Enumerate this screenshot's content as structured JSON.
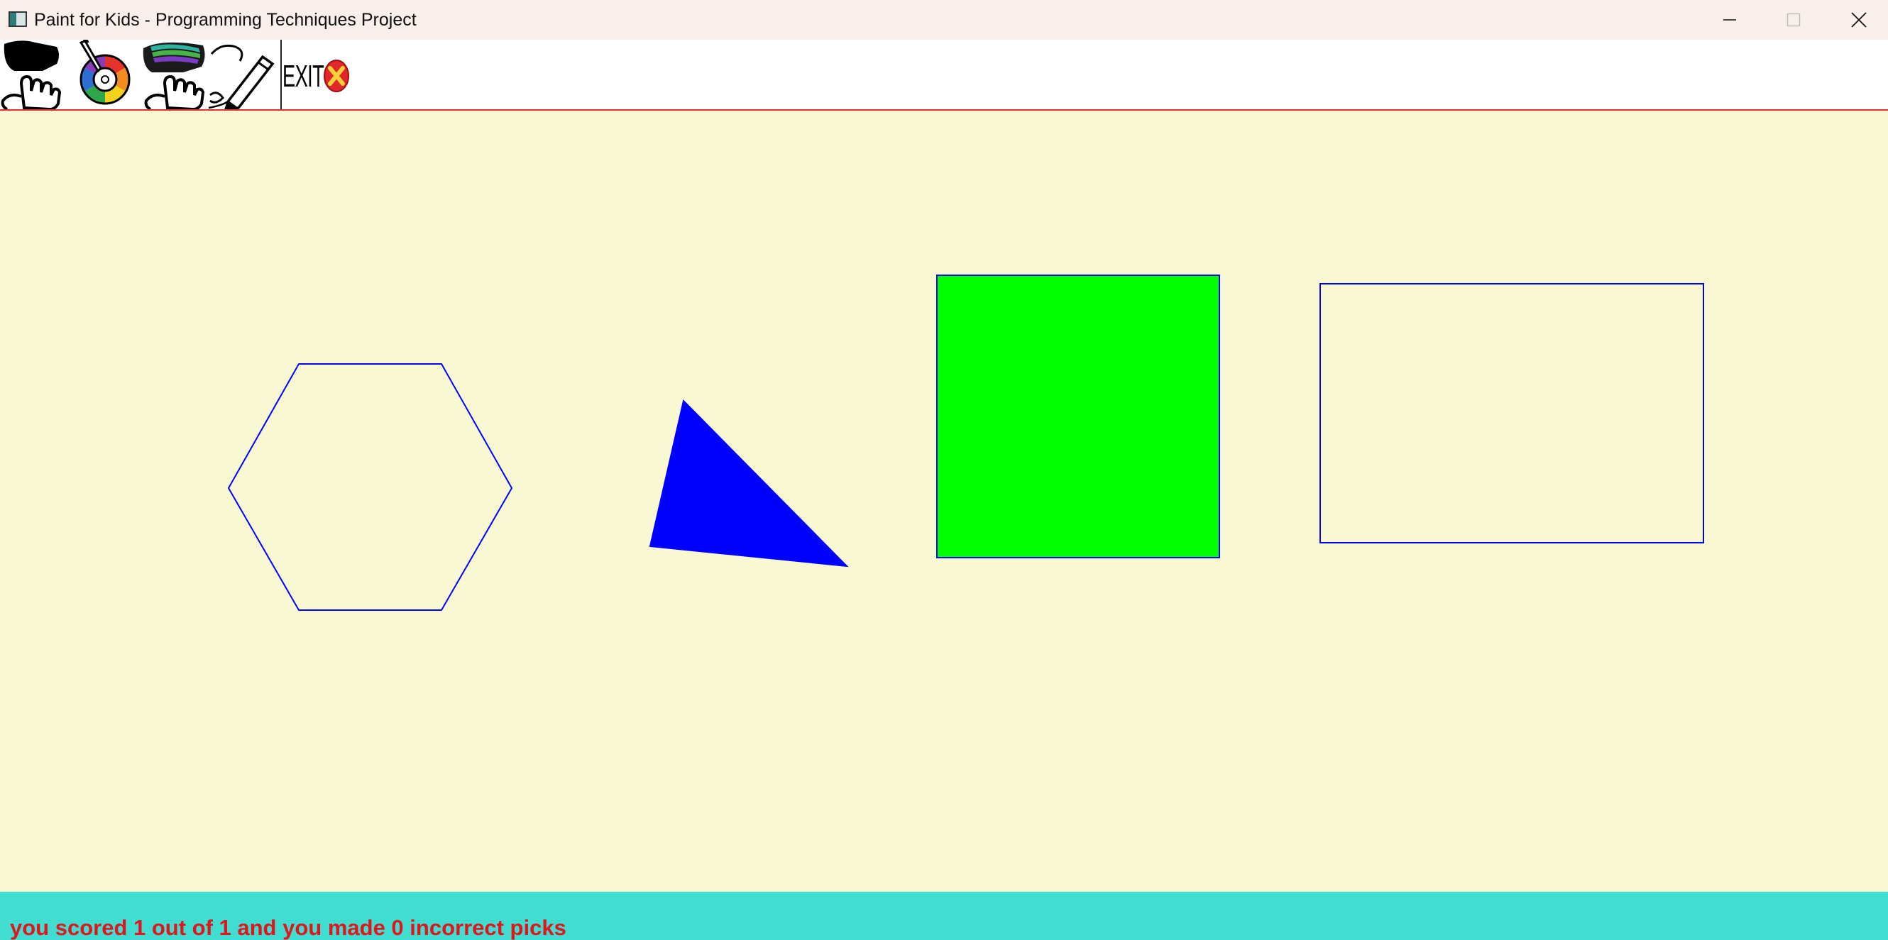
{
  "window": {
    "title": "Paint for Kids - Programming Techniques Project",
    "controls": {
      "minimize": "minimize-icon",
      "maximize": "maximize-icon",
      "close": "close-icon"
    }
  },
  "toolbar": {
    "items": [
      {
        "name": "pick-by-shape-tool",
        "icon": "hand-pointer-shape-icon"
      },
      {
        "name": "pick-by-color-tool",
        "icon": "color-wheel-icon"
      },
      {
        "name": "pick-by-shape-and-color-tool",
        "icon": "hand-pointer-rainbow-icon"
      },
      {
        "name": "draw-mode-tool",
        "icon": "pencil-icon"
      }
    ],
    "exit_label": "EXIT"
  },
  "canvas": {
    "background": "#f8f8d2",
    "shapes": [
      {
        "type": "hexagon",
        "border_color": "#0000ff",
        "fill": "none"
      },
      {
        "type": "triangle",
        "border_color": "#0000ff",
        "fill": "#0000ff"
      },
      {
        "type": "square",
        "border_color": "#0000ff",
        "fill": "#00ff00"
      },
      {
        "type": "rectangle",
        "border_color": "#0000ff",
        "fill": "none"
      }
    ]
  },
  "status": {
    "message": "you scored 1 out of 1 and you made 0 incorrect picks",
    "text_color": "#e0161e",
    "background": "#40ddd0"
  }
}
